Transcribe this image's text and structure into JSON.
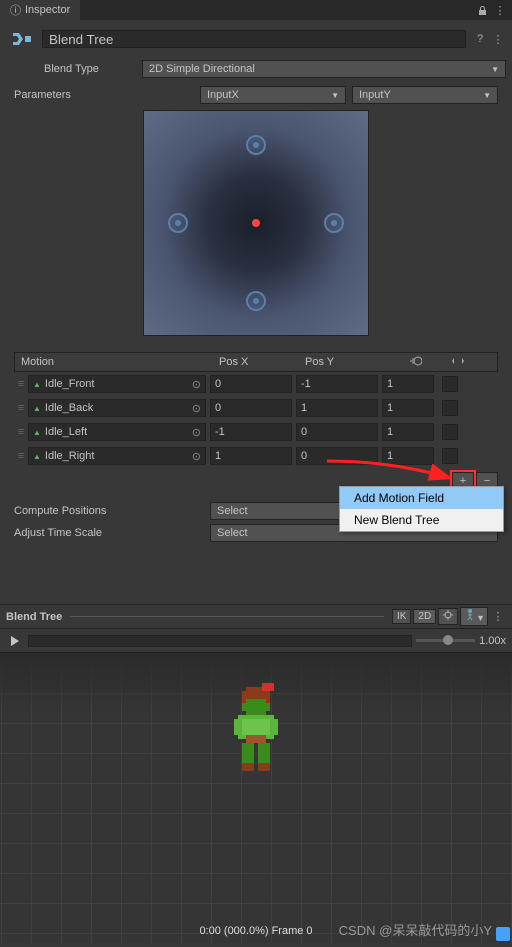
{
  "tab": {
    "title": "Inspector"
  },
  "header": {
    "name": "Blend Tree",
    "blendTypeLabel": "Blend Type",
    "blendType": "2D Simple Directional"
  },
  "params": {
    "label": "Parameters",
    "x": "InputX",
    "y": "InputY"
  },
  "motionTable": {
    "headers": {
      "motion": "Motion",
      "posx": "Pos X",
      "posy": "Pos Y"
    },
    "rows": [
      {
        "name": "Idle_Front",
        "posx": "0",
        "posy": "-1",
        "speed": "1"
      },
      {
        "name": "Idle_Back",
        "posx": "0",
        "posy": "1",
        "speed": "1"
      },
      {
        "name": "Idle_Left",
        "posx": "-1",
        "posy": "0",
        "speed": "1"
      },
      {
        "name": "Idle_Right",
        "posx": "1",
        "posy": "0",
        "speed": "1"
      }
    ]
  },
  "contextMenu": {
    "addMotion": "Add Motion Field",
    "newBlendTree": "New Blend Tree"
  },
  "compute": {
    "positionsLabel": "Compute Positions",
    "timeScaleLabel": "Adjust Time Scale",
    "select": "Select"
  },
  "preview": {
    "title": "Blend Tree",
    "ik": "IK",
    "mode2d": "2D",
    "speed": "1.00x",
    "frameInfo": "0:00 (000.0%) Frame 0"
  },
  "watermark": "CSDN @呆呆敲代码的小Y"
}
